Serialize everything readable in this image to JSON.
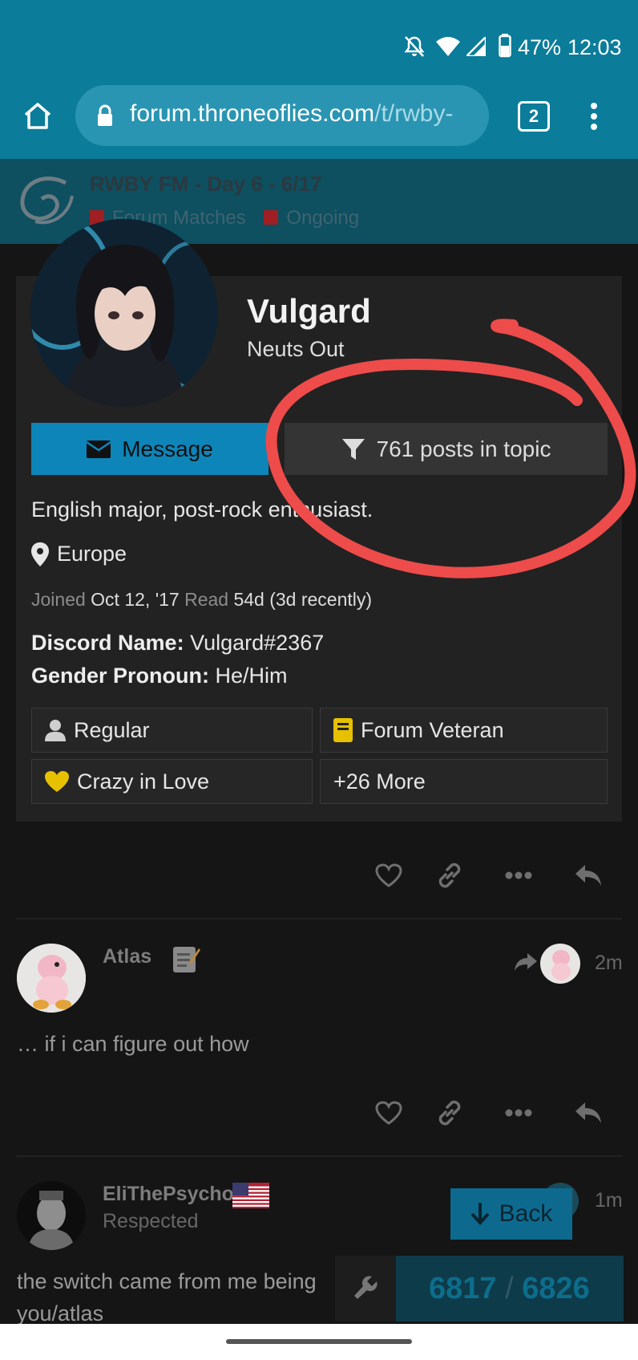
{
  "status": {
    "battery": "47%",
    "time": "12:03",
    "icons": [
      "mute-icon",
      "wifi-icon",
      "signal-icon",
      "battery-icon"
    ]
  },
  "browser": {
    "url_domain": "forum.throneoflies.com",
    "url_path": "/t/rwby-",
    "tab_count": "2"
  },
  "topic": {
    "title": "RWBY FM - Day 6 - 6/17",
    "categories": [
      "Forum Matches",
      "Ongoing"
    ]
  },
  "user": {
    "name": "Vulgard",
    "title": "Neuts Out",
    "message_label": "Message",
    "posts_label": "761 posts in topic",
    "bio": "English major, post-rock enthusiast.",
    "location": "Europe",
    "joined_label": "Joined",
    "joined_value": "Oct 12, '17",
    "read_label": "Read",
    "read_value": "54d (3d recently)",
    "fields": [
      {
        "label": "Discord Name:",
        "value": "Vulgard#2367"
      },
      {
        "label": "Gender Pronoun:",
        "value": "He/Him"
      }
    ],
    "badges": [
      {
        "label": "Regular",
        "icon": "user-icon",
        "color": "#cfcfcf"
      },
      {
        "label": "Forum Veteran",
        "icon": "book-icon",
        "color": "#e7c000"
      },
      {
        "label": "Crazy in Love",
        "icon": "heart-icon",
        "color": "#e7c000"
      },
      {
        "label": "+26 More"
      }
    ]
  },
  "posts": [
    {
      "author": "Atlas",
      "time": "2m",
      "text": "… if i can figure out how"
    },
    {
      "author": "EliThePsycho",
      "subtitle": "Respected",
      "time": "1m",
      "text": "the switch came from me being",
      "text2": "you/atlas"
    }
  ],
  "footer": {
    "back_label": "Back",
    "progress_current": "6817",
    "progress_sep": "/",
    "progress_total": "6826"
  },
  "accent": {
    "annotation_red": "#ee4b4b",
    "header_teal": "#0b7c9a",
    "button_blue": "#0e85b8"
  }
}
